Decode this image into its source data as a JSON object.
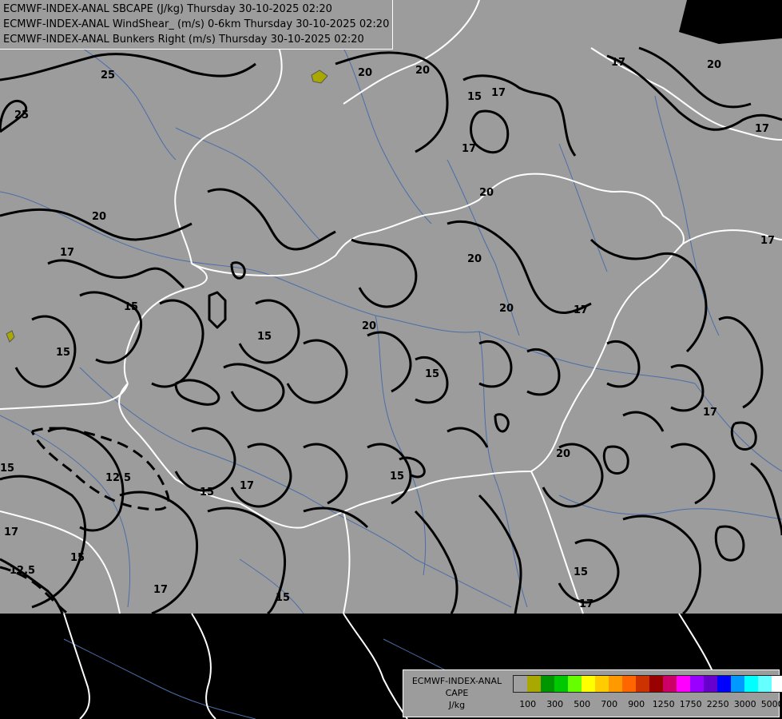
{
  "header": {
    "line1": "ECMWF-INDEX-ANAL SBCAPE (J/kg) Thursday 30-10-2025 02:20",
    "line2": "ECMWF-INDEX-ANAL WindShear_ (m/s) 0-6km Thursday 30-10-2025 02:20",
    "line3": "ECMWF-INDEX-ANAL Bunkers Right (m/s) Thursday 30-10-2025 02:20"
  },
  "legend": {
    "title_line1": "ECMWF-INDEX-ANAL",
    "title_line2": "CAPE",
    "title_line3": "J/kg",
    "ticks": [
      "100",
      "300",
      "500",
      "700",
      "900",
      "1250",
      "1750",
      "2250",
      "3000",
      "5000"
    ],
    "colors": [
      "#a0a0a0",
      "#a8a800",
      "#009600",
      "#00c800",
      "#66ff00",
      "#ffff00",
      "#ffcc00",
      "#ff9900",
      "#ff6600",
      "#cc3300",
      "#990000",
      "#cc0066",
      "#ff00ff",
      "#9900ff",
      "#6600cc",
      "#0000ff",
      "#0099ff",
      "#00ffff",
      "#66ffff",
      "#ffffff"
    ]
  },
  "contour_labels": [
    "25",
    "25",
    "20",
    "20",
    "17",
    "20",
    "15",
    "17",
    "17",
    "20",
    "17",
    "20",
    "17",
    "20",
    "20",
    "17",
    "15",
    "15",
    "15",
    "15",
    "20",
    "17",
    "15",
    "20",
    "12.5",
    "15",
    "17",
    "17",
    "15",
    "12.5",
    "17",
    "15",
    "15",
    "15",
    "17",
    "17"
  ],
  "colors": {
    "land": "#9c9c9c",
    "sea_outside": "#000000",
    "border": "#ffffff",
    "river": "#4a6ea8",
    "contour": "#000000",
    "cape_cell": "#a8a800"
  }
}
